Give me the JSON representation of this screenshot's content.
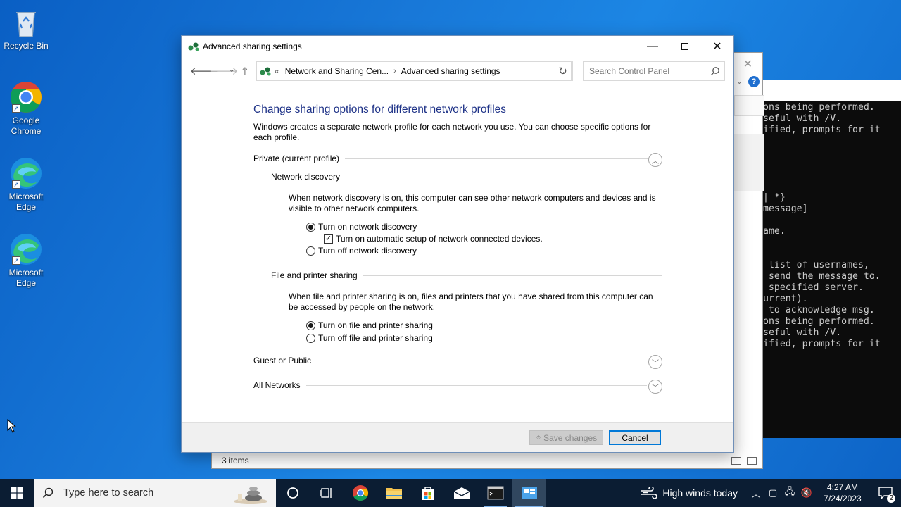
{
  "desktop": {
    "icons": [
      {
        "label": "Recycle Bin"
      },
      {
        "label": "Google Chrome"
      },
      {
        "label": "Microsoft Edge"
      },
      {
        "label": "Microsoft Edge"
      }
    ]
  },
  "background_explorer": {
    "status": "3 items"
  },
  "cmd": {
    "lines": [
      "ons being performed.",
      "seful with /V.",
      "ified, prompts for it",
      "",
      "",
      "",
      "",
      "",
      "| *}",
      "message]",
      "",
      "ame.",
      "",
      "",
      " list of usernames,",
      " send the message to.",
      " specified server.",
      "urrent).",
      " to acknowledge msg.",
      "ons being performed.",
      "seful with /V.",
      "ified, prompts for it"
    ]
  },
  "window": {
    "title": "Advanced sharing settings",
    "address": {
      "overflow": "«",
      "crumb1": "Network and Sharing Cen...",
      "crumb2": "Advanced sharing settings"
    },
    "search_placeholder": "Search Control Panel",
    "heading": "Change sharing options for different network profiles",
    "intro": "Windows creates a separate network profile for each network you use. You can choose specific options for each profile.",
    "private": {
      "title": "Private (current profile)",
      "network_discovery": {
        "title": "Network discovery",
        "description": "When network discovery is on, this computer can see other network computers and devices and is visible to other network computers.",
        "opt_on": "Turn on network discovery",
        "opt_auto": "Turn on automatic setup of network connected devices.",
        "opt_off": "Turn off network discovery",
        "selected": "on",
        "auto_setup_checked": true
      },
      "file_printer": {
        "title": "File and printer sharing",
        "description": "When file and printer sharing is on, files and printers that you have shared from this computer can be accessed by people on the network.",
        "opt_on": "Turn on file and printer sharing",
        "opt_off": "Turn off file and printer sharing",
        "selected": "on"
      }
    },
    "guest_public": "Guest or Public",
    "all_networks": "All Networks",
    "save_label": "Save changes",
    "cancel_label": "Cancel"
  },
  "taskbar": {
    "search_placeholder": "Type here to search",
    "weather": "High winds today",
    "time": "4:27 AM",
    "date": "7/24/2023",
    "notification_count": "2"
  },
  "colors": {
    "heading": "#1e3287",
    "desktop": "#1878d8",
    "taskbar": "#0b1d33",
    "accent": "#0078d7"
  }
}
